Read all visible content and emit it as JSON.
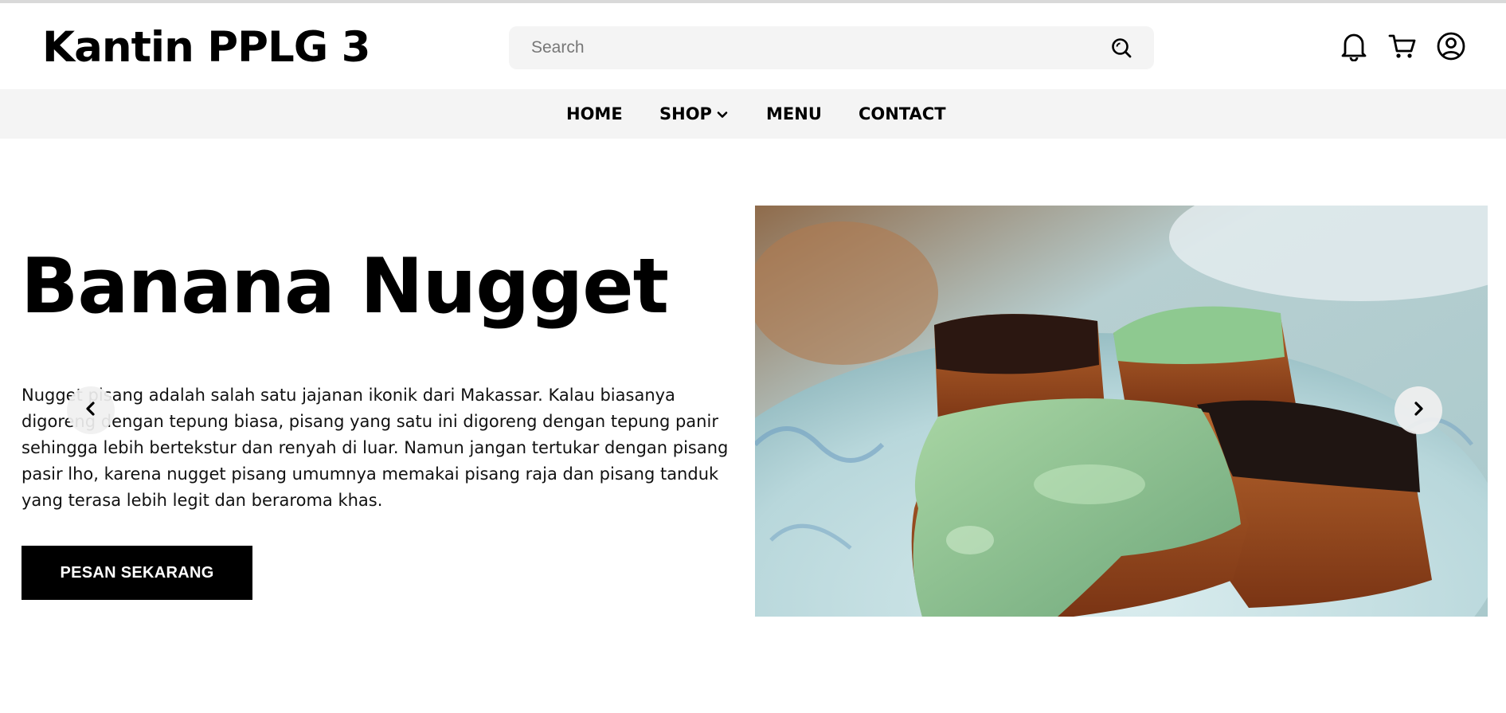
{
  "header": {
    "brand": "Kantin PPLG 3",
    "search": {
      "placeholder": "Search",
      "value": ""
    },
    "icons": [
      "search-icon",
      "bell-icon",
      "cart-icon",
      "user-icon"
    ]
  },
  "nav": {
    "items": [
      {
        "label": "HOME"
      },
      {
        "label": "SHOP",
        "has_dropdown": true
      },
      {
        "label": "MENU"
      },
      {
        "label": "CONTACT"
      }
    ]
  },
  "hero": {
    "title": "Banana Nugget",
    "description": "Nugget pisang adalah salah satu jajanan ikonik dari Makassar. Kalau biasanya digoreng dengan tepung biasa, pisang yang satu ini digoreng dengan tepung panir sehingga lebih bertekstur dan renyah di luar. Namun jangan tertukar dengan pisang pasir lho, karena nugget pisang umumnya memakai pisang raja dan pisang tanduk yang terasa lebih legit dan beraroma khas.",
    "cta_label": "PESAN SEKARANG",
    "image": "banana-nugget-photo"
  },
  "carousel": {
    "prev": "chevron-left-icon",
    "next": "chevron-right-icon"
  },
  "colors": {
    "background": "#ffffff",
    "nav_bg": "#f4f4f4",
    "search_bg": "#f4f4f4",
    "button_bg": "#000000",
    "button_text": "#ffffff"
  }
}
